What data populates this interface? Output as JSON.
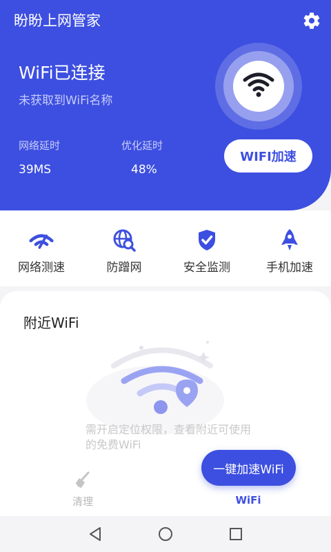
{
  "app": {
    "title": "盼盼上网管家"
  },
  "header": {
    "status_title": "WiFi已连接",
    "status_sub": "未获取到WiFi名称",
    "metrics": [
      {
        "label": "网络延时",
        "value": "39MS"
      },
      {
        "label": "优化延时",
        "value": "48%"
      }
    ],
    "accel_button": "WIFI加速"
  },
  "tools": [
    {
      "label": "网络测速",
      "icon": "speed-test-icon"
    },
    {
      "label": "防蹭网",
      "icon": "globe-search-icon"
    },
    {
      "label": "安全监测",
      "icon": "shield-check-icon"
    },
    {
      "label": "手机加速",
      "icon": "rocket-icon"
    }
  ],
  "nearby": {
    "title": "附近WiFi",
    "permission_text": "需开启定位权限，查看附近可使用的免费WiFi",
    "one_key_button": "一键加速WiFi"
  },
  "tabbar": {
    "tabs": [
      {
        "label": "清理",
        "icon": "broom-icon",
        "active": false
      },
      {
        "label": "WiFi",
        "icon": "wifi-icon",
        "active": true
      }
    ]
  },
  "colors": {
    "primary": "#3d4fe0",
    "inactive": "#b8b8b8"
  }
}
